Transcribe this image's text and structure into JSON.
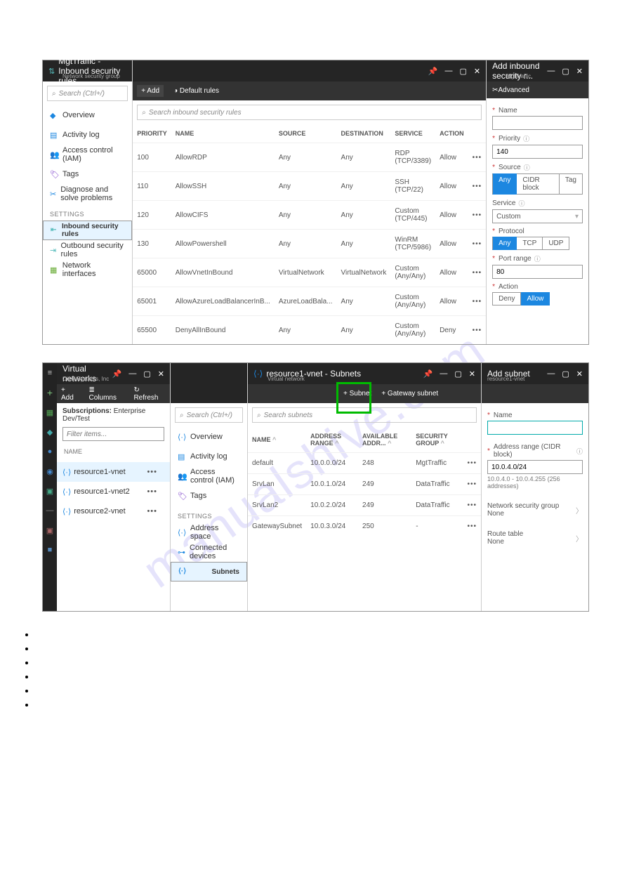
{
  "shot1": {
    "titlebar": {
      "icon_hint": "nsg",
      "title": "MgtTraffic - Inbound security rules",
      "subtitle": "Network security group"
    },
    "cmdbar": {
      "add": "+ Add",
      "default_rules": "Default rules"
    },
    "left_search_ph": "Search (Ctrl+/)",
    "sidemenu": {
      "overview": "Overview",
      "activity": "Activity log",
      "iam": "Access control (IAM)",
      "tags": "Tags",
      "diag": "Diagnose and solve problems",
      "settings_hdr": "SETTINGS",
      "inbound": "Inbound security rules",
      "outbound": "Outbound security rules",
      "nics": "Network interfaces"
    },
    "mid_search_ph": "Search inbound security rules",
    "rules_headers": {
      "priority": "PRIORITY",
      "name": "NAME",
      "source": "SOURCE",
      "dest": "DESTINATION",
      "service": "SERVICE",
      "action": "ACTION"
    },
    "rules": [
      {
        "pr": "100",
        "name": "AllowRDP",
        "src": "Any",
        "dst": "Any",
        "svc": "RDP (TCP/3389)",
        "act": "Allow",
        "actclass": "allow"
      },
      {
        "pr": "110",
        "name": "AllowSSH",
        "src": "Any",
        "dst": "Any",
        "svc": "SSH (TCP/22)",
        "act": "Allow",
        "actclass": "allow"
      },
      {
        "pr": "120",
        "name": "AllowCIFS",
        "src": "Any",
        "dst": "Any",
        "svc": "Custom (TCP/445)",
        "act": "Allow",
        "actclass": "allow"
      },
      {
        "pr": "130",
        "name": "AllowPowershell",
        "src": "Any",
        "dst": "Any",
        "svc": "WinRM (TCP/5986)",
        "act": "Allow",
        "actclass": "allow"
      },
      {
        "pr": "65000",
        "name": "AllowVnetInBound",
        "src": "VirtualNetwork",
        "dst": "VirtualNetwork",
        "svc": "Custom (Any/Any)",
        "act": "Allow",
        "actclass": "allow"
      },
      {
        "pr": "65001",
        "name": "AllowAzureLoadBalancerInB...",
        "src": "AzureLoadBala...",
        "dst": "Any",
        "svc": "Custom (Any/Any)",
        "act": "Allow",
        "actclass": "allow"
      },
      {
        "pr": "65500",
        "name": "DenyAllInBound",
        "src": "Any",
        "dst": "Any",
        "svc": "Custom (Any/Any)",
        "act": "Deny",
        "actclass": "deny"
      }
    ],
    "right": {
      "title": "Add inbound security r...",
      "subtitle": "MgtTraffic",
      "advanced": "Advanced",
      "name_lbl": "Name",
      "priority_lbl": "Priority",
      "priority_val": "140",
      "source_lbl": "Source",
      "source_opts": {
        "any": "Any",
        "cidr": "CIDR block",
        "tag": "Tag"
      },
      "service_lbl": "Service",
      "service_val": "Custom",
      "protocol_lbl": "Protocol",
      "protocol_opts": {
        "any": "Any",
        "tcp": "TCP",
        "udp": "UDP"
      },
      "portrange_lbl": "Port range",
      "portrange_val": "80",
      "action_lbl": "Action",
      "action_opts": {
        "deny": "Deny",
        "allow": "Allow"
      }
    }
  },
  "shot2": {
    "rail_icons": [
      "≡",
      "+",
      "■",
      "◆",
      "●",
      "◉",
      "■",
      "—",
      "▣",
      "■"
    ],
    "col_a": {
      "title": "Virtual networks",
      "subtitle": "Citrix Systems, Inc",
      "cmds": {
        "add": "+ Add",
        "columns": "≣ Columns",
        "refresh": "↻ Refresh"
      },
      "subscriptions_lbl": "Subscriptions:",
      "subscriptions_val": "Enterprise Dev/Test",
      "filter_ph": "Filter items...",
      "name_hdr": "NAME",
      "rows": [
        {
          "name": "resource1-vnet",
          "sel": true
        },
        {
          "name": "resource1-vnet2",
          "sel": false
        },
        {
          "name": "resource2-vnet",
          "sel": false
        }
      ]
    },
    "col_b": {
      "title": "resource1-vnet - Subnets",
      "subtitle": "Virtual network",
      "search_ph": "Search (Ctrl+/)",
      "items": {
        "overview": "Overview",
        "activity": "Activity log",
        "iam": "Access control (IAM)",
        "tags": "Tags",
        "settings_hdr": "SETTINGS",
        "addr": "Address space",
        "conn": "Connected devices",
        "subnets": "Subnets"
      }
    },
    "col_c": {
      "cmds": {
        "subnet": "+ Subnet",
        "gateway": "+ Gateway subnet"
      },
      "search_ph": "Search subnets",
      "headers": {
        "name": "NAME",
        "addr": "ADDRESS RANGE",
        "avail": "AVAILABLE ADDR...",
        "nsg": "SECURITY GROUP"
      },
      "rows": [
        {
          "name": "default",
          "addr": "10.0.0.0/24",
          "avail": "248",
          "nsg": "MgtTraffic"
        },
        {
          "name": "SrvLan",
          "addr": "10.0.1.0/24",
          "avail": "249",
          "nsg": "DataTraffic"
        },
        {
          "name": "SrvLan2",
          "addr": "10.0.2.0/24",
          "avail": "249",
          "nsg": "DataTraffic"
        },
        {
          "name": "GatewaySubnet",
          "addr": "10.0.3.0/24",
          "avail": "250",
          "nsg": "-"
        }
      ]
    },
    "col_d": {
      "title": "Add subnet",
      "subtitle": "resource1-vnet",
      "name_lbl": "Name",
      "addr_lbl": "Address range (CIDR block)",
      "addr_val": "10.0.4.0/24",
      "addr_hint": "10.0.4.0 - 10.0.4.255 (256 addresses)",
      "nsg_lbl": "Network security group",
      "nsg_val": "None",
      "rt_lbl": "Route table",
      "rt_val": "None"
    }
  },
  "watermark": "manualshive.com"
}
